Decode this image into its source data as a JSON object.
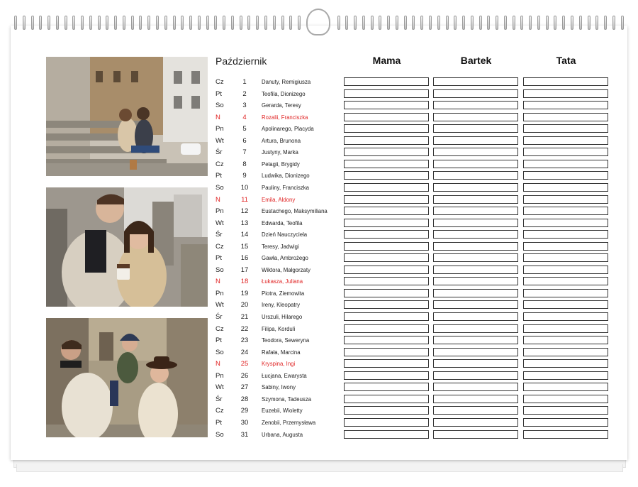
{
  "month": "Październik",
  "columns": [
    "Mama",
    "Bartek",
    "Tata"
  ],
  "days": [
    {
      "dow": "Cz",
      "num": "1",
      "names": "Danuty, Remigiusza",
      "sunday": false
    },
    {
      "dow": "Pt",
      "num": "2",
      "names": "Teofila, Dionizego",
      "sunday": false
    },
    {
      "dow": "So",
      "num": "3",
      "names": "Gerarda, Teresy",
      "sunday": false
    },
    {
      "dow": "N",
      "num": "4",
      "names": "Rozalii, Franciszka",
      "sunday": true
    },
    {
      "dow": "Pn",
      "num": "5",
      "names": "Apolinarego, Placyda",
      "sunday": false
    },
    {
      "dow": "Wt",
      "num": "6",
      "names": "Artura, Brunona",
      "sunday": false
    },
    {
      "dow": "Śr",
      "num": "7",
      "names": "Justyny, Marka",
      "sunday": false
    },
    {
      "dow": "Cz",
      "num": "8",
      "names": "Pelagii, Brygidy",
      "sunday": false
    },
    {
      "dow": "Pt",
      "num": "9",
      "names": "Ludwika, Dionizego",
      "sunday": false
    },
    {
      "dow": "So",
      "num": "10",
      "names": "Pauliny, Franciszka",
      "sunday": false
    },
    {
      "dow": "N",
      "num": "11",
      "names": "Emila, Aldony",
      "sunday": true
    },
    {
      "dow": "Pn",
      "num": "12",
      "names": "Eustachego, Maksymiliana",
      "sunday": false
    },
    {
      "dow": "Wt",
      "num": "13",
      "names": "Edwarda, Teofila",
      "sunday": false
    },
    {
      "dow": "Śr",
      "num": "14",
      "names": "Dzień Nauczyciela",
      "sunday": false
    },
    {
      "dow": "Cz",
      "num": "15",
      "names": "Teresy, Jadwigi",
      "sunday": false
    },
    {
      "dow": "Pt",
      "num": "16",
      "names": "Gawła, Ambrożego",
      "sunday": false
    },
    {
      "dow": "So",
      "num": "17",
      "names": "Wiktora, Małgorzaty",
      "sunday": false
    },
    {
      "dow": "N",
      "num": "18",
      "names": "Łukasza, Juliana",
      "sunday": true
    },
    {
      "dow": "Pn",
      "num": "19",
      "names": "Piotra, Ziemowita",
      "sunday": false
    },
    {
      "dow": "Wt",
      "num": "20",
      "names": "Ireny, Kleopatry",
      "sunday": false
    },
    {
      "dow": "Śr",
      "num": "21",
      "names": "Urszuli, Hilarego",
      "sunday": false
    },
    {
      "dow": "Cz",
      "num": "22",
      "names": "Filipa, Korduli",
      "sunday": false
    },
    {
      "dow": "Pt",
      "num": "23",
      "names": "Teodora, Seweryna",
      "sunday": false
    },
    {
      "dow": "So",
      "num": "24",
      "names": "Rafała, Marcina",
      "sunday": false
    },
    {
      "dow": "N",
      "num": "25",
      "names": "Kryspina, Ingi",
      "sunday": true
    },
    {
      "dow": "Pn",
      "num": "26",
      "names": "Łucjana, Ewarysta",
      "sunday": false
    },
    {
      "dow": "Wt",
      "num": "27",
      "names": "Sabiny, Iwony",
      "sunday": false
    },
    {
      "dow": "Śr",
      "num": "28",
      "names": "Szymona, Tadeusza",
      "sunday": false
    },
    {
      "dow": "Cz",
      "num": "29",
      "names": "Euzebii, Wioletty",
      "sunday": false
    },
    {
      "dow": "Pt",
      "num": "30",
      "names": "Zenobii, Przemysława",
      "sunday": false
    },
    {
      "dow": "So",
      "num": "31",
      "names": "Urbana, Augusta",
      "sunday": false
    }
  ],
  "colors": {
    "sunday": "#e02424",
    "text": "#222222",
    "box_border": "#333333"
  },
  "photos": [
    "couple-on-stairs-photo",
    "couple-with-coffee-photo",
    "family-with-child-photo"
  ]
}
